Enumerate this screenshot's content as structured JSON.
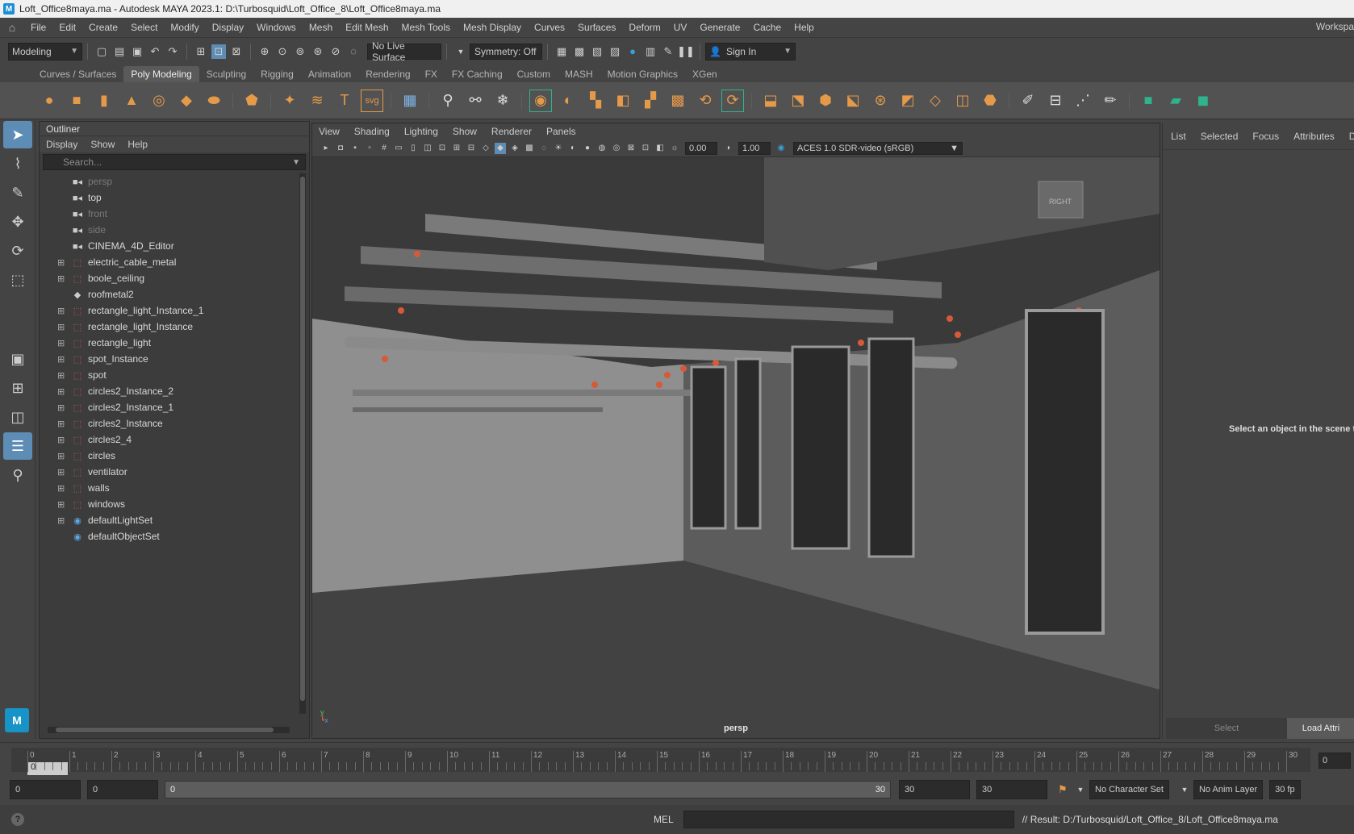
{
  "window": {
    "title": "Loft_Office8maya.ma - Autodesk MAYA 2023.1: D:\\Turbosquid\\Loft_Office_8\\Loft_Office8maya.ma"
  },
  "menubar": {
    "items": [
      "File",
      "Edit",
      "Create",
      "Select",
      "Modify",
      "Display",
      "Windows",
      "Mesh",
      "Edit Mesh",
      "Mesh Tools",
      "Mesh Display",
      "Curves",
      "Surfaces",
      "Deform",
      "UV",
      "Generate",
      "Cache",
      "Help"
    ],
    "workspace": "Workspa"
  },
  "statusline": {
    "mode": "Modeling",
    "live_surface": "No Live Surface",
    "symmetry": "Symmetry: Off",
    "sign_in": "Sign In"
  },
  "shelf": {
    "tabs": [
      "Curves / Surfaces",
      "Poly Modeling",
      "Sculpting",
      "Rigging",
      "Animation",
      "Rendering",
      "FX",
      "FX Caching",
      "Custom",
      "MASH",
      "Motion Graphics",
      "XGen"
    ],
    "active_tab": "Poly Modeling"
  },
  "outliner": {
    "title": "Outliner",
    "menu": [
      "Display",
      "Show",
      "Help"
    ],
    "search_placeholder": "Search...",
    "items": [
      {
        "label": "persp",
        "icon": "camera-icon",
        "expandable": false,
        "dim": true
      },
      {
        "label": "top",
        "icon": "camera-icon",
        "expandable": false,
        "dim": false
      },
      {
        "label": "front",
        "icon": "camera-icon",
        "expandable": false,
        "dim": true
      },
      {
        "label": "side",
        "icon": "camera-icon",
        "expandable": false,
        "dim": true
      },
      {
        "label": "CINEMA_4D_Editor",
        "icon": "camera-icon",
        "expandable": false,
        "dim": false
      },
      {
        "label": "electric_cable_metal",
        "icon": "group-icon",
        "expandable": true,
        "dim": false
      },
      {
        "label": "boole_ceiling",
        "icon": "group-icon",
        "expandable": true,
        "dim": false
      },
      {
        "label": "roofmetal2",
        "icon": "mesh-icon",
        "expandable": false,
        "dim": false
      },
      {
        "label": "rectangle_light_Instance_1",
        "icon": "group-icon",
        "expandable": true,
        "dim": false
      },
      {
        "label": "rectangle_light_Instance",
        "icon": "group-icon",
        "expandable": true,
        "dim": false
      },
      {
        "label": "rectangle_light",
        "icon": "group-icon",
        "expandable": true,
        "dim": false
      },
      {
        "label": "spot_Instance",
        "icon": "group-icon",
        "expandable": true,
        "dim": false
      },
      {
        "label": "spot",
        "icon": "group-icon",
        "expandable": true,
        "dim": false
      },
      {
        "label": "circles2_Instance_2",
        "icon": "group-icon",
        "expandable": true,
        "dim": false
      },
      {
        "label": "circles2_Instance_1",
        "icon": "group-icon",
        "expandable": true,
        "dim": false
      },
      {
        "label": "circles2_Instance",
        "icon": "group-icon",
        "expandable": true,
        "dim": false
      },
      {
        "label": "circles2_4",
        "icon": "group-icon",
        "expandable": true,
        "dim": false
      },
      {
        "label": "circles",
        "icon": "group-icon",
        "expandable": true,
        "dim": false
      },
      {
        "label": "ventilator",
        "icon": "group-icon",
        "expandable": true,
        "dim": false
      },
      {
        "label": "walls",
        "icon": "group-icon",
        "expandable": true,
        "dim": false
      },
      {
        "label": "windows",
        "icon": "group-icon",
        "expandable": true,
        "dim": false
      },
      {
        "label": "defaultLightSet",
        "icon": "set-icon",
        "expandable": true,
        "dim": false
      },
      {
        "label": "defaultObjectSet",
        "icon": "set-icon",
        "expandable": false,
        "dim": false
      }
    ]
  },
  "viewport": {
    "menu": [
      "View",
      "Shading",
      "Lighting",
      "Show",
      "Renderer",
      "Panels"
    ],
    "exposure": "0.00",
    "gamma": "1.00",
    "color_space": "ACES 1.0 SDR-video (sRGB)",
    "camera_label": "persp",
    "view_cube_label": "RIGHT"
  },
  "right_panel": {
    "tabs": [
      "List",
      "Selected",
      "Focus",
      "Attributes",
      "Displ"
    ],
    "message": "Select an object in the scene to",
    "select_button": "Select",
    "load_button": "Load Attri"
  },
  "timeline": {
    "ticks": [
      "0",
      "1",
      "2",
      "3",
      "4",
      "5",
      "6",
      "7",
      "8",
      "9",
      "10",
      "11",
      "12",
      "13",
      "14",
      "15",
      "16",
      "17",
      "18",
      "19",
      "20",
      "21",
      "22",
      "23",
      "24",
      "25",
      "26",
      "27",
      "28",
      "29",
      "30"
    ],
    "current_frame": "0",
    "right_frame": "0"
  },
  "range": {
    "start": "0",
    "start_inner": "0",
    "bar_start": "0",
    "bar_end": "30",
    "end_inner": "30",
    "end": "30",
    "character_set": "No Character Set",
    "anim_layer": "No Anim Layer",
    "fps": "30 fp"
  },
  "commandline": {
    "language": "MEL",
    "result": "// Result: D:/Turbosquid/Loft_Office_8/Loft_Office8maya.ma"
  },
  "colors": {
    "accent": "#5d8cb5",
    "shelf_icon": "#e59a4a",
    "maya_logo": "#1793c8"
  }
}
